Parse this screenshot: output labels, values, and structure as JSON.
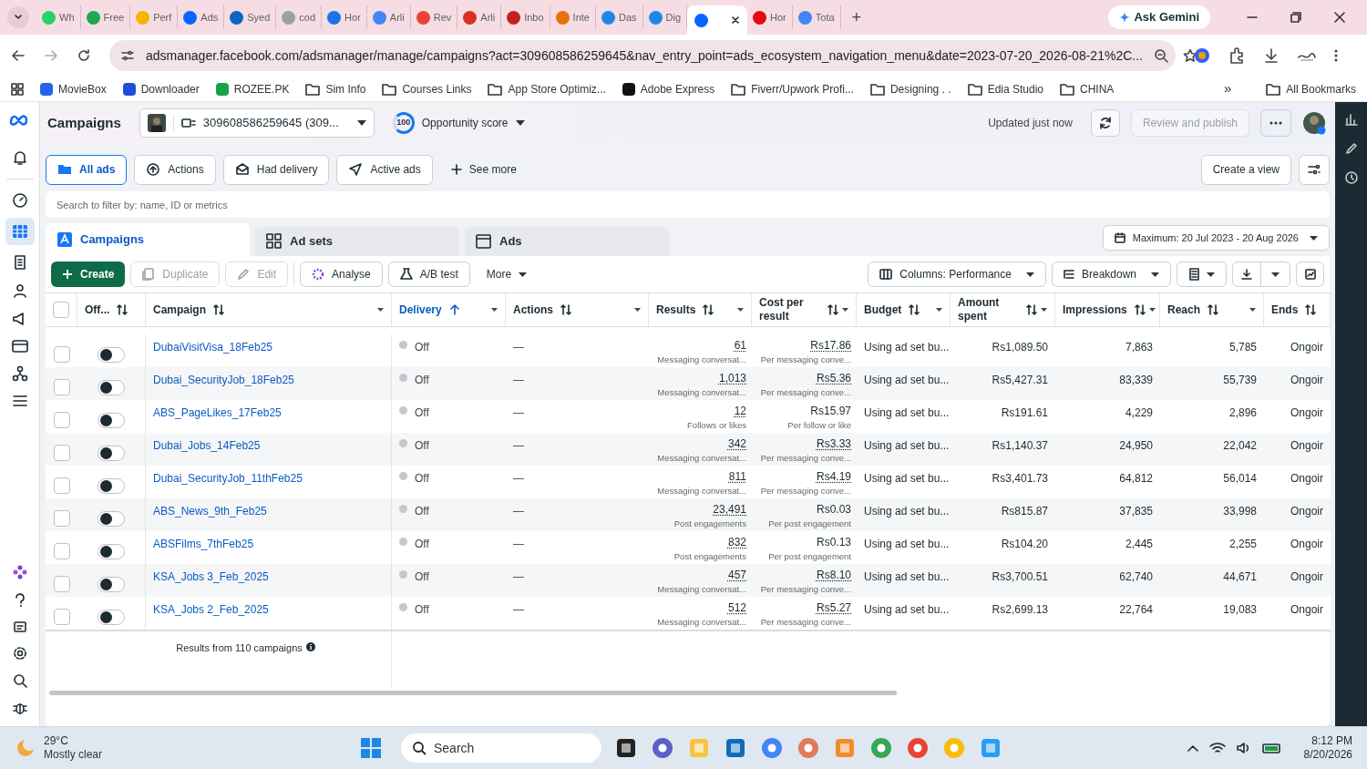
{
  "browser": {
    "tabs": [
      {
        "title": "Wh",
        "color": "#25d366",
        "selected": false
      },
      {
        "title": "Free",
        "color": "#1da851",
        "selected": false
      },
      {
        "title": "Perf",
        "color": "#f4b400",
        "selected": false
      },
      {
        "title": "Ads",
        "color": "#0866ff",
        "selected": false
      },
      {
        "title": "Syed",
        "color": "#0a66c2",
        "selected": false
      },
      {
        "title": "cod",
        "color": "#9aa0a6",
        "selected": false
      },
      {
        "title": "Hor",
        "color": "#1a73e8",
        "selected": false
      },
      {
        "title": "Arli",
        "color": "#4285f4",
        "selected": false
      },
      {
        "title": "Rev",
        "color": "#ea4335",
        "selected": false
      },
      {
        "title": "Arli",
        "color": "#d93025",
        "selected": false
      },
      {
        "title": "Inbo",
        "color": "#c5221f",
        "selected": false
      },
      {
        "title": "Inte",
        "color": "#e8710a",
        "selected": false
      },
      {
        "title": "Das",
        "color": "#1e88e5",
        "selected": false
      },
      {
        "title": "Dig",
        "color": "#1e88e5",
        "selected": false
      },
      {
        "color": "#0866ff",
        "selected": true
      },
      {
        "title": "Hor",
        "color": "#e50914",
        "selected": false
      },
      {
        "title": "Tota",
        "color": "#4285f4",
        "selected": false
      }
    ],
    "new_tab": "+",
    "ask_gemini": "Ask Gemini",
    "address": "adsmanager.facebook.com/adsmanager/manage/campaigns?act=309608586259645&nav_entry_point=ads_ecosystem_navigation_menu&date=2023-07-20_2026-08-21%2C...",
    "bookmarks": [
      {
        "label": "MovieBox",
        "kind": "site",
        "color": "#2563eb"
      },
      {
        "label": "Downloader",
        "kind": "site",
        "color": "#1d4ed8"
      },
      {
        "label": "ROZEE.PK",
        "kind": "site",
        "color": "#16a34a"
      },
      {
        "label": "Sim Info",
        "kind": "folder"
      },
      {
        "label": "Courses Links",
        "kind": "folder"
      },
      {
        "label": "App Store Optimiz...",
        "kind": "folder"
      },
      {
        "label": "Adobe Express",
        "kind": "site",
        "color": "#111111"
      },
      {
        "label": "Fiverr/Upwork Profi...",
        "kind": "folder"
      },
      {
        "label": "Designing . .",
        "kind": "folder"
      },
      {
        "label": "Edia Studio",
        "kind": "folder"
      },
      {
        "label": "CHINA",
        "kind": "folder"
      }
    ],
    "more": "»",
    "all_bookmarks": "All Bookmarks"
  },
  "header": {
    "title": "Campaigns",
    "account": "309608586259645 (309...",
    "score": "100",
    "score_label": "Opportunity score",
    "updated": "Updated just now",
    "review": {
      "label": "Review and publish",
      "disabled": true
    }
  },
  "filters": [
    {
      "label": "All ads",
      "selected": true
    },
    {
      "label": "Actions",
      "selected": false
    },
    {
      "label": "Had delivery",
      "selected": false
    },
    {
      "label": "Active ads",
      "selected": false
    }
  ],
  "see_more": "See more",
  "create_view": "Create a view",
  "search": {
    "placeholder": "Search to filter by: name, ID or metrics"
  },
  "level_tabs": [
    {
      "label": "Campaigns",
      "selected": true
    },
    {
      "label": "Ad sets",
      "selected": false
    },
    {
      "label": "Ads",
      "selected": false
    }
  ],
  "date_range": "Maximum: 20 Jul 2023 - 20 Aug 2026",
  "toolbar": [
    {
      "label": "Create",
      "kind": "primary"
    },
    {
      "label": "Duplicate",
      "kind": "plain",
      "disabled": true
    },
    {
      "label": "Edit",
      "kind": "plain",
      "disabled": true
    },
    {
      "label": "Analyse",
      "kind": "plain",
      "disabled": false
    },
    {
      "label": "A/B test",
      "kind": "plain",
      "disabled": false
    },
    {
      "label": "More",
      "kind": "menu"
    }
  ],
  "columns_button": "Columns: Performance",
  "breakdown_button": "Breakdown",
  "table": {
    "all_checked": false,
    "columns": [
      {
        "label": "Off...",
        "sorted": false
      },
      {
        "label": "Campaign",
        "sorted": false
      },
      {
        "label": "Delivery",
        "sorted": true
      },
      {
        "label": "Actions",
        "sorted": false
      },
      {
        "label": "Results",
        "sorted": false
      },
      {
        "label": "Cost per result",
        "sorted": false
      },
      {
        "label": "Budget",
        "sorted": false
      },
      {
        "label": "Amount spent",
        "sorted": false
      },
      {
        "label": "Impressions",
        "sorted": false
      },
      {
        "label": "Reach",
        "sorted": false
      },
      {
        "label": "Ends",
        "sorted": false
      }
    ],
    "rows": [
      {
        "campaign": "DubaiVisitVisa_18Feb25",
        "checked": false,
        "on": false,
        "delivery": "Off",
        "actions": "—",
        "results": "61",
        "results_label": "Messaging conversat...",
        "cost": "Rs17.86",
        "cost_underlined": true,
        "cost_label": "Per messaging conve...",
        "budget": "Using ad set bu...",
        "amount": "Rs1,089.50",
        "impressions": "7,863",
        "reach": "5,785",
        "ends": "Ongoir"
      },
      {
        "campaign": "Dubai_SecurityJob_18Feb25",
        "checked": false,
        "on": false,
        "delivery": "Off",
        "actions": "—",
        "results": "1,013",
        "results_label": "Messaging conversat...",
        "cost": "Rs5.36",
        "cost_underlined": true,
        "cost_label": "Per messaging conve...",
        "budget": "Using ad set bu...",
        "amount": "Rs5,427.31",
        "impressions": "83,339",
        "reach": "55,739",
        "ends": "Ongoir"
      },
      {
        "campaign": "ABS_PageLikes_17Feb25",
        "checked": false,
        "on": false,
        "delivery": "Off",
        "actions": "—",
        "results": "12",
        "results_label": "Follows or likes",
        "cost": "Rs15.97",
        "cost_underlined": false,
        "cost_label": "Per follow or like",
        "budget": "Using ad set bu...",
        "amount": "Rs191.61",
        "impressions": "4,229",
        "reach": "2,896",
        "ends": "Ongoir"
      },
      {
        "campaign": "Dubai_Jobs_14Feb25",
        "checked": false,
        "on": false,
        "delivery": "Off",
        "actions": "—",
        "results": "342",
        "results_label": "Messaging conversat...",
        "cost": "Rs3.33",
        "cost_underlined": true,
        "cost_label": "Per messaging conve...",
        "budget": "Using ad set bu...",
        "amount": "Rs1,140.37",
        "impressions": "24,950",
        "reach": "22,042",
        "ends": "Ongoir"
      },
      {
        "campaign": "Dubai_SecurityJob_11thFeb25",
        "checked": false,
        "on": false,
        "delivery": "Off",
        "actions": "—",
        "results": "811",
        "results_label": "Messaging conversat...",
        "cost": "Rs4.19",
        "cost_underlined": true,
        "cost_label": "Per messaging conve...",
        "budget": "Using ad set bu...",
        "amount": "Rs3,401.73",
        "impressions": "64,812",
        "reach": "56,014",
        "ends": "Ongoir"
      },
      {
        "campaign": "ABS_News_9th_Feb25",
        "checked": false,
        "on": false,
        "delivery": "Off",
        "actions": "—",
        "results": "23,491",
        "results_label": "Post engagements",
        "cost": "Rs0.03",
        "cost_underlined": false,
        "cost_label": "Per post engagement",
        "budget": "Using ad set bu...",
        "amount": "Rs815.87",
        "impressions": "37,835",
        "reach": "33,998",
        "ends": "Ongoir"
      },
      {
        "campaign": "ABSFilms_7thFeb25",
        "checked": false,
        "on": false,
        "delivery": "Off",
        "actions": "—",
        "results": "832",
        "results_label": "Post engagements",
        "cost": "Rs0.13",
        "cost_underlined": false,
        "cost_label": "Per post engagement",
        "budget": "Using ad set bu...",
        "amount": "Rs104.20",
        "impressions": "2,445",
        "reach": "2,255",
        "ends": "Ongoir"
      },
      {
        "campaign": "KSA_Jobs 3_Feb_2025",
        "checked": false,
        "on": false,
        "delivery": "Off",
        "actions": "—",
        "results": "457",
        "results_label": "Messaging conversat...",
        "cost": "Rs8.10",
        "cost_underlined": true,
        "cost_label": "Per messaging conve...",
        "budget": "Using ad set bu...",
        "amount": "Rs3,700.51",
        "impressions": "62,740",
        "reach": "44,671",
        "ends": "Ongoir"
      },
      {
        "campaign": "KSA_Jobs 2_Feb_2025",
        "checked": false,
        "on": false,
        "delivery": "Off",
        "actions": "—",
        "results": "512",
        "results_label": "Messaging conversat...",
        "cost": "Rs5.27",
        "cost_underlined": true,
        "cost_label": "Per messaging conve...",
        "budget": "Using ad set bu...",
        "amount": "Rs2,699.13",
        "impressions": "22,764",
        "reach": "19,083",
        "ends": "Ongoir"
      }
    ],
    "footer": "Results from 110 campaigns"
  },
  "taskbar": {
    "temperature": "29°C",
    "weather": "Mostly clear",
    "search": "Search",
    "time": "8:12 PM",
    "date": "8/20/2026"
  }
}
